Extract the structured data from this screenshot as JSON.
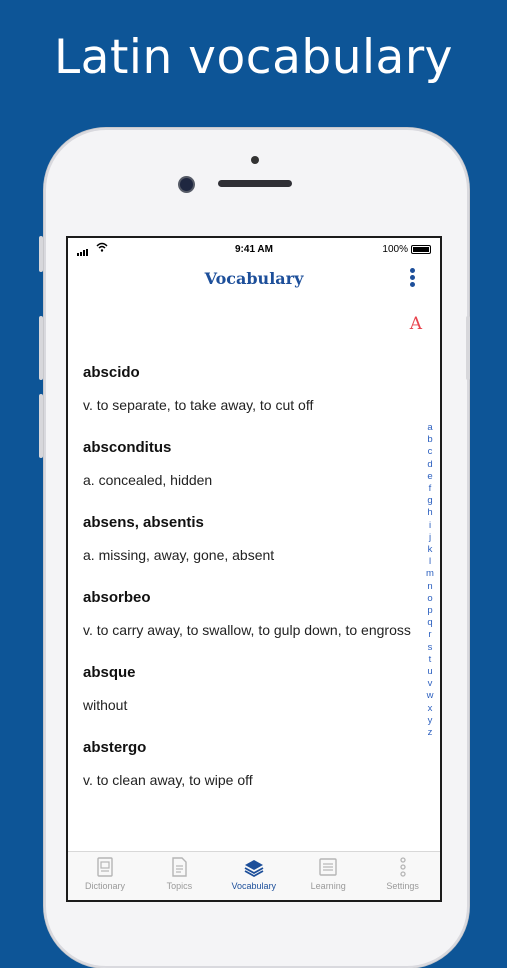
{
  "headline": "Latin vocabulary",
  "status": {
    "time": "9:41 AM",
    "battery": "100%"
  },
  "nav": {
    "title": "Vocabulary",
    "font_glyph": "A"
  },
  "entries": [
    {
      "word": "abscido",
      "def": "v. to separate, to take away, to cut off"
    },
    {
      "word": "absconditus",
      "def": "a. concealed, hidden"
    },
    {
      "word": "absens, absentis",
      "def": "a. missing, away, gone, absent"
    },
    {
      "word": "absorbeo",
      "def": "v. to carry away, to swallow, to gulp down, to engross"
    },
    {
      "word": "absque",
      "def": "without"
    },
    {
      "word": "abstergo",
      "def": "v. to clean away, to wipe off"
    }
  ],
  "alphabet": [
    "a",
    "b",
    "c",
    "d",
    "e",
    "f",
    "g",
    "h",
    "i",
    "j",
    "k",
    "l",
    "m",
    "n",
    "o",
    "p",
    "q",
    "r",
    "s",
    "t",
    "u",
    "v",
    "w",
    "x",
    "y",
    "z"
  ],
  "tabs": [
    {
      "label": "Dictionary",
      "icon": "dictionary-icon",
      "active": false
    },
    {
      "label": "Topics",
      "icon": "topics-icon",
      "active": false
    },
    {
      "label": "Vocabulary",
      "icon": "vocabulary-icon",
      "active": true
    },
    {
      "label": "Learning",
      "icon": "learning-icon",
      "active": false
    },
    {
      "label": "Settings",
      "icon": "settings-icon",
      "active": false
    }
  ],
  "colors": {
    "background": "#0d5597",
    "accent": "#1d4f9a",
    "font_icon": "#e8424c",
    "index": "#2b5fbf"
  }
}
